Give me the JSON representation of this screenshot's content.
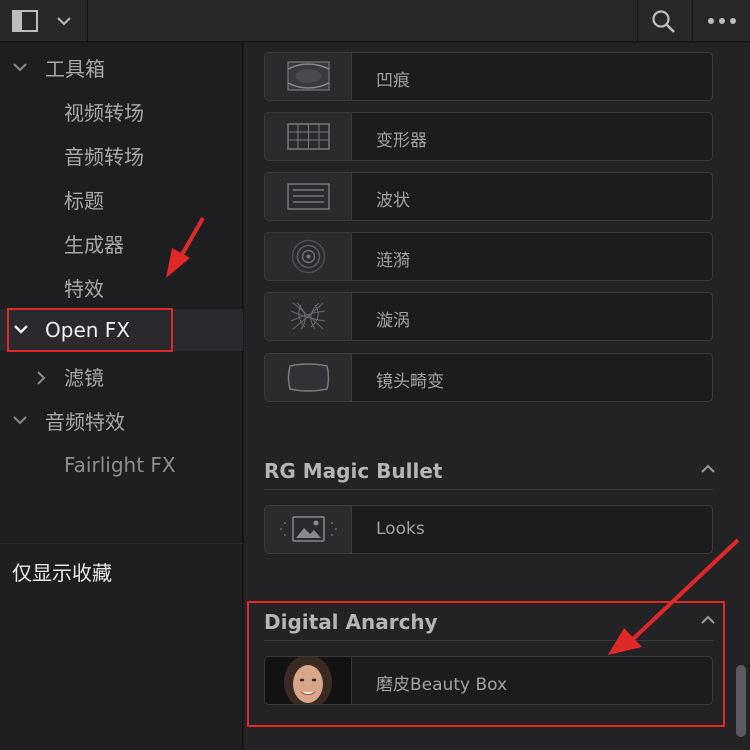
{
  "left_panel": {
    "toolbox": "工具箱",
    "video_transitions": "视频转场",
    "audio_transitions": "音频转场",
    "titles": "标题",
    "generators": "生成器",
    "effects": "特效",
    "open_fx": "Open FX",
    "filters": "滤镜",
    "audio_fx": "音频特效",
    "fairlight_fx": "Fairlight FX",
    "favorites_only": "仅显示收藏"
  },
  "effects_list": [
    {
      "label": "凹痕",
      "icon": "dent-icon"
    },
    {
      "label": "变形器",
      "icon": "warper-grid-icon"
    },
    {
      "label": "波状",
      "icon": "wave-icon"
    },
    {
      "label": "涟漪",
      "icon": "ripple-icon"
    },
    {
      "label": "漩涡",
      "icon": "vortex-icon"
    },
    {
      "label": "镜头畸变",
      "icon": "lens-distortion-icon"
    }
  ],
  "sections": {
    "rg_magic_bullet": {
      "title": "RG Magic Bullet",
      "items": [
        {
          "label": "Looks",
          "icon": "looks-icon"
        }
      ]
    },
    "digital_anarchy": {
      "title": "Digital Anarchy",
      "items": [
        {
          "label": "磨皮Beauty Box",
          "icon": "beauty-box-face-thumbnail"
        }
      ]
    }
  },
  "colors": {
    "annotation_red": "#e02828"
  }
}
